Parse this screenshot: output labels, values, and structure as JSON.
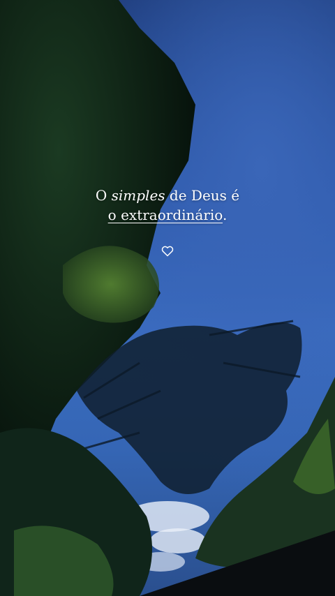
{
  "quote": {
    "line1_a": "O ",
    "line1_b": "simples",
    "line1_c": " de Deus é",
    "line2_a": "o ",
    "line2_b": "extraordinário",
    "line2_c": "."
  },
  "icons": {
    "heart": "heart-outline-icon"
  },
  "colors": {
    "sky_top": "#1d3a78",
    "sky_mid": "#3a6cc0",
    "foliage_dark": "#0d1f16",
    "foliage_light": "#4f7a2e",
    "text": "#ffffff"
  }
}
